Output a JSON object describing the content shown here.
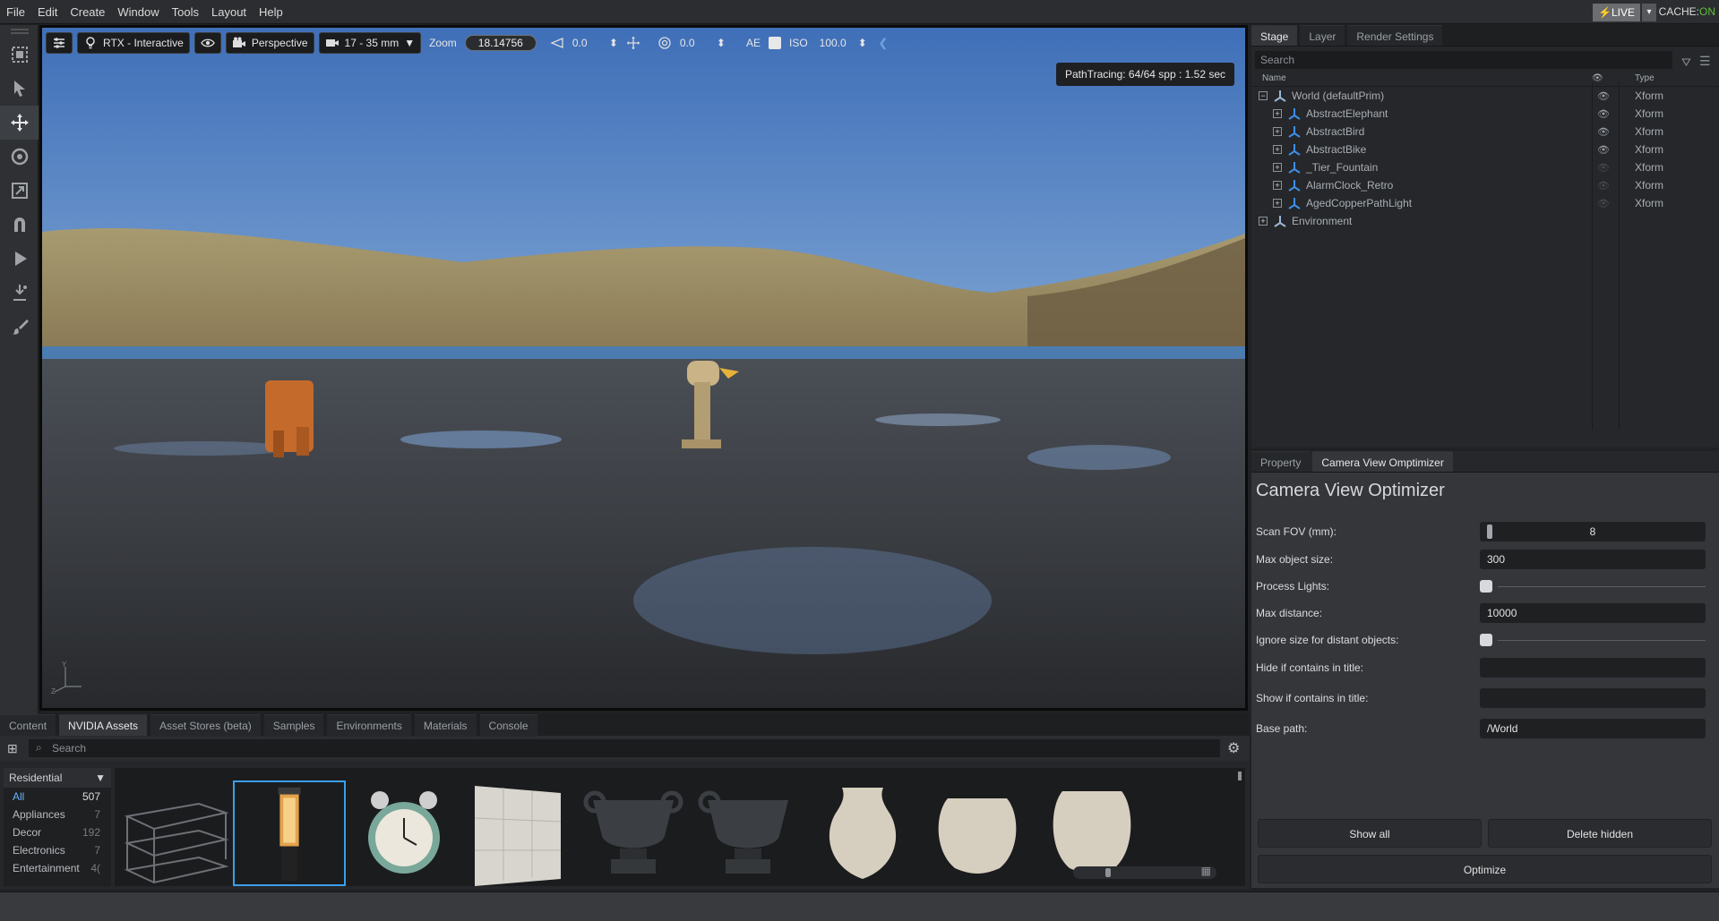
{
  "menu": [
    "File",
    "Edit",
    "Create",
    "Window",
    "Tools",
    "Layout",
    "Help"
  ],
  "live": {
    "label": "⚡LIVE",
    "cache_label": "CACHE:",
    "cache_state": "ON"
  },
  "viewport": {
    "renderer": "RTX - Interactive",
    "camera": "Perspective",
    "lens": "17 - 35 mm",
    "zoom_label": "Zoom",
    "zoom_value": "18.14756",
    "exposure": "0.0",
    "aperture": "0.0",
    "ae_label": "AE",
    "iso_label": "ISO",
    "iso_value": "100.0",
    "pathtracing": "PathTracing: 64/64 spp : 1.52 sec"
  },
  "stage": {
    "tabs": [
      "Stage",
      "Layer",
      "Render Settings"
    ],
    "search_placeholder": "Search",
    "col_name": "Name",
    "col_type": "Type",
    "items": [
      {
        "name": "World (defaultPrim)",
        "type": "Xform",
        "depth": 0,
        "expander": "−",
        "visible": true
      },
      {
        "name": "AbstractElephant",
        "type": "Xform",
        "depth": 1,
        "expander": "+",
        "visible": true
      },
      {
        "name": "AbstractBird",
        "type": "Xform",
        "depth": 1,
        "expander": "+",
        "visible": true
      },
      {
        "name": "AbstractBike",
        "type": "Xform",
        "depth": 1,
        "expander": "+",
        "visible": true
      },
      {
        "name": "_Tier_Fountain",
        "type": "Xform",
        "depth": 1,
        "expander": "+",
        "visible": false
      },
      {
        "name": "AlarmClock_Retro",
        "type": "Xform",
        "depth": 1,
        "expander": "+",
        "visible": false
      },
      {
        "name": "AgedCopperPathLight",
        "type": "Xform",
        "depth": 1,
        "expander": "+",
        "visible": false
      },
      {
        "name": "Environment",
        "type": "",
        "depth": 0,
        "expander": "+",
        "visible": null
      }
    ]
  },
  "property": {
    "tabs": [
      "Property",
      "Camera View Omptimizer"
    ],
    "title": "Camera View Optimizer",
    "fields": {
      "scan_fov_label": "Scan FOV (mm):",
      "scan_fov_value": "8",
      "max_obj_label": "Max object size:",
      "max_obj_value": "300",
      "process_lights_label": "Process Lights:",
      "max_dist_label": "Max distance:",
      "max_dist_value": "10000",
      "ignore_label": "Ignore size for distant objects:",
      "hide_label": "Hide if contains in title:",
      "show_label": "Show if contains in title:",
      "base_label": "Base path:",
      "base_value": "/World"
    },
    "buttons": {
      "show_all": "Show all",
      "delete_hidden": "Delete hidden",
      "optimize": "Optimize"
    }
  },
  "content": {
    "tabs": [
      "Content",
      "NVIDIA Assets",
      "Asset Stores (beta)",
      "Samples",
      "Environments",
      "Materials",
      "Console"
    ],
    "search_placeholder": "Search",
    "category_select": "Residential",
    "categories": [
      {
        "name": "All",
        "count": "507"
      },
      {
        "name": "Appliances",
        "count": "7"
      },
      {
        "name": "Decor",
        "count": "192"
      },
      {
        "name": "Electronics",
        "count": "7"
      },
      {
        "name": "Entertainment",
        "count": "4("
      }
    ],
    "thumbnails": [
      "glass-shelf",
      "path-light",
      "alarm-clock",
      "tile-panel",
      "urn-ornate",
      "urn-ornate-2",
      "vase",
      "pot",
      "pot-2"
    ]
  }
}
